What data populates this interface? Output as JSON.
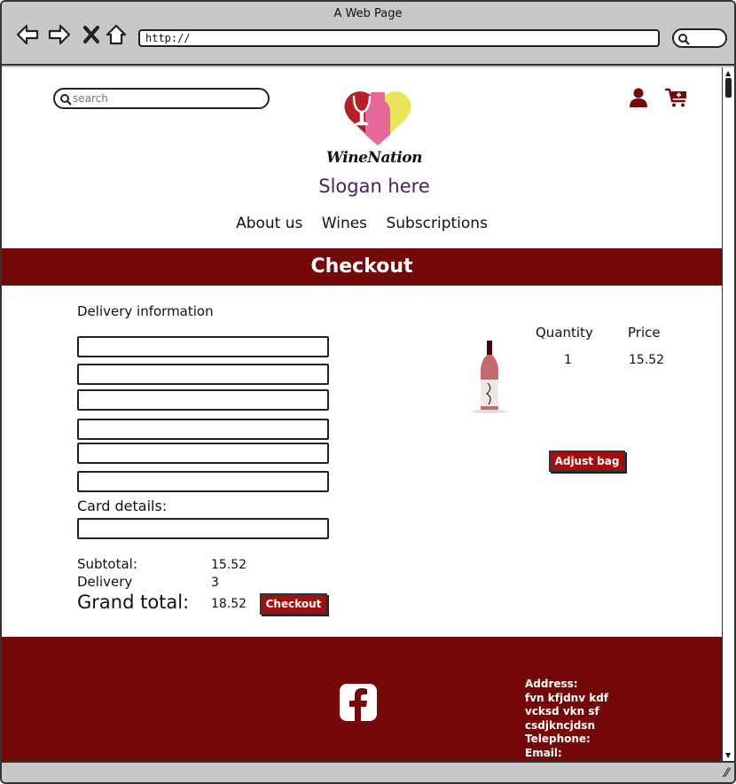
{
  "window": {
    "title": "A Web Page",
    "url": "http://"
  },
  "header": {
    "search_placeholder": "search",
    "brand": "WineNation",
    "slogan": "Slogan here",
    "nav": [
      "About us",
      "Wines",
      "Subscriptions"
    ]
  },
  "banner": {
    "title": "Checkout"
  },
  "form": {
    "delivery_label": "Delivery information",
    "card_label": "Card details:"
  },
  "totals": {
    "subtotal_label": "Subtotal:",
    "subtotal_value": "15.52",
    "delivery_label": "Delivery",
    "delivery_value": "3",
    "grand_label": "Grand total:",
    "grand_value": "18.52",
    "checkout_button": "Checkout"
  },
  "bag": {
    "quantity_header": "Quantity",
    "price_header": "Price",
    "quantity": "1",
    "price": "15.52",
    "adjust_button": "Adjust bag"
  },
  "footer": {
    "address_label": "Address:",
    "address_lines": [
      "fvn kfjdnv kdf",
      "vcksd vkn sf",
      "csdjkncjdsn"
    ],
    "telephone_label": "Telephone:",
    "email_label": "Email:"
  },
  "colors": {
    "brand_red": "#750808",
    "button_red": "#a30e0e",
    "slogan_purple": "#4a2359"
  }
}
